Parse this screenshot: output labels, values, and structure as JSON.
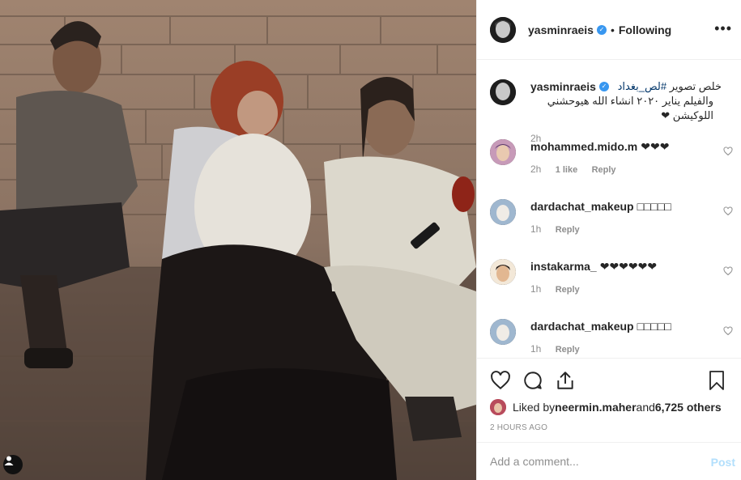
{
  "post": {
    "photo_alt": "photo",
    "header": {
      "username": "yasminraeis",
      "verified_mark": "✓",
      "separator": "•",
      "follow_status": "Following",
      "more_icon": "more-horizontal-icon"
    },
    "caption": {
      "username": "yasminraeis",
      "line1_prefix": "خلص تصوير ",
      "hashtag": "#لص_بغداد",
      "line2": "والفيلم يناير ٢٠٢٠ انشاء الله هيوحشني اللوكيشن ❤",
      "time": "2h"
    },
    "comments": [
      {
        "username": "mohammed.mido.m",
        "text": "❤❤❤",
        "time": "2h",
        "likes": "1 like",
        "reply": "Reply"
      },
      {
        "username": "dardachat_makeup",
        "text": "□□□□□",
        "time": "1h",
        "reply": "Reply"
      },
      {
        "username": "instakarma_",
        "text": "❤❤❤❤❤❤",
        "time": "1h",
        "reply": "Reply"
      },
      {
        "username": "dardachat_makeup",
        "text": "□□□□□",
        "time": "1h",
        "reply": "Reply"
      }
    ],
    "likes": {
      "prefix": "Liked by ",
      "user": "neermin.maher",
      "middle": " and ",
      "others": "6,725 others"
    },
    "timestamp": "2 HOURS AGO",
    "add_comment": {
      "placeholder": "Add a comment...",
      "post_label": "Post"
    },
    "colors": {
      "verified": "#3897f0",
      "post_disabled": "#b2dffc",
      "muted": "#8e8e8e",
      "hashtag": "#003569"
    }
  }
}
